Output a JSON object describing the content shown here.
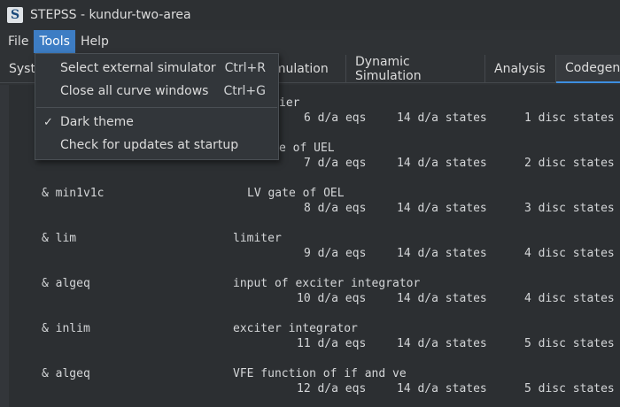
{
  "window": {
    "title": "STEPSS - kundur-two-area",
    "icon_letter": "S"
  },
  "menubar": {
    "items": [
      "File",
      "Tools",
      "Help"
    ],
    "active": "Tools"
  },
  "tabs": [
    {
      "label": "Syst"
    },
    {
      "label": "imulation"
    },
    {
      "label": "Dynamic Simulation"
    },
    {
      "label": "Analysis"
    },
    {
      "label": "Codegen"
    }
  ],
  "tools_menu": {
    "items": [
      {
        "label": "Select external simulator",
        "shortcut": "Ctrl+R"
      },
      {
        "label": "Close all curve windows",
        "shortcut": "Ctrl+G"
      },
      {
        "label": "Dark theme",
        "checked_mark": "✓"
      },
      {
        "label": "Check for updates at startup"
      }
    ]
  },
  "code": {
    "partial_lines": [
      "ier",
      "e of UEL"
    ],
    "blocks": [
      {
        "name": "",
        "desc": "",
        "eqs": "6 d/a eqs",
        "states": "14 d/a states",
        "disc": "1 disc states"
      },
      {
        "name": "",
        "desc": "",
        "eqs": "7 d/a eqs",
        "states": "14 d/a states",
        "disc": "2 disc states"
      },
      {
        "name": "& min1v1c",
        "desc": "LV gate of OEL",
        "eqs": "8 d/a eqs",
        "states": "14 d/a states",
        "disc": "3 disc states"
      },
      {
        "name": "& lim",
        "desc": "limiter",
        "eqs": "9 d/a eqs",
        "states": "14 d/a states",
        "disc": "4 disc states"
      },
      {
        "name": "& algeq",
        "desc": "input of exciter integrator",
        "eqs": "10 d/a eqs",
        "states": "14 d/a states",
        "disc": "4 disc states"
      },
      {
        "name": "& inlim",
        "desc": "exciter integrator",
        "eqs": "11 d/a eqs",
        "states": "14 d/a states",
        "disc": "5 disc states"
      },
      {
        "name": "& algeq",
        "desc": "VFE function of if and ve",
        "eqs": "12 d/a eqs",
        "states": "14 d/a states",
        "disc": "5 disc states"
      }
    ]
  }
}
